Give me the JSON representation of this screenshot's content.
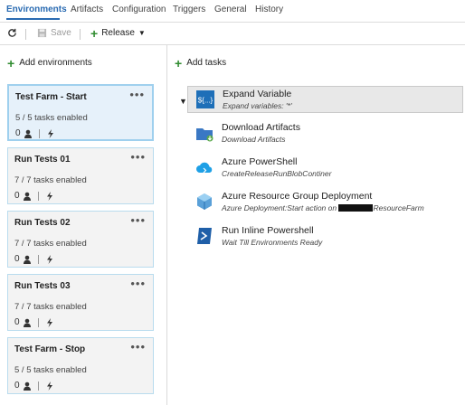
{
  "tabs": [
    {
      "label": "Environments",
      "active": true
    },
    {
      "label": "Artifacts"
    },
    {
      "label": "Configuration"
    },
    {
      "label": "Triggers"
    },
    {
      "label": "General"
    },
    {
      "label": "History"
    }
  ],
  "toolbar": {
    "refresh_icon": "refresh-icon",
    "save_label": "Save",
    "release_label": "Release"
  },
  "left": {
    "add_label": "Add environments"
  },
  "environments": [
    {
      "name": "Test Farm - Start",
      "tasks": "5 / 5 tasks enabled",
      "count": "0",
      "selected": true
    },
    {
      "name": "Run Tests 01",
      "tasks": "7 / 7 tasks enabled",
      "count": "0"
    },
    {
      "name": "Run Tests 02",
      "tasks": "7 / 7 tasks enabled",
      "count": "0"
    },
    {
      "name": "Run Tests 03",
      "tasks": "7 / 7 tasks enabled",
      "count": "0"
    },
    {
      "name": "Test Farm - Stop",
      "tasks": "5 / 5 tasks enabled",
      "count": "0"
    }
  ],
  "right": {
    "add_label": "Add tasks"
  },
  "tasks": [
    {
      "title": "Expand Variable",
      "subtitle": "Expand variables: '*'",
      "icon": "expand-variable-icon",
      "selected": true
    },
    {
      "title": "Download Artifacts",
      "subtitle": "Download Artifacts",
      "icon": "download-folder-icon"
    },
    {
      "title": "Azure PowerShell",
      "subtitle": "CreateReleaseRunBlobContiner",
      "icon": "azure-cloud-icon"
    },
    {
      "title": "Azure Resource Group Deployment",
      "subtitle_prefix": "Azure Deployment:Start action on",
      "subtitle_suffix": "ResourceFarm",
      "icon": "resource-group-icon"
    },
    {
      "title": "Run Inline Powershell",
      "subtitle": "Wait Till Environments Ready",
      "icon": "powershell-icon"
    }
  ],
  "colors": {
    "accent": "#2a6bb2",
    "add_green": "#2f8b2f",
    "card_border": "#b9dcee",
    "card_bg": "#f3f3f3",
    "selected_card_bg": "#e6f1fa"
  }
}
